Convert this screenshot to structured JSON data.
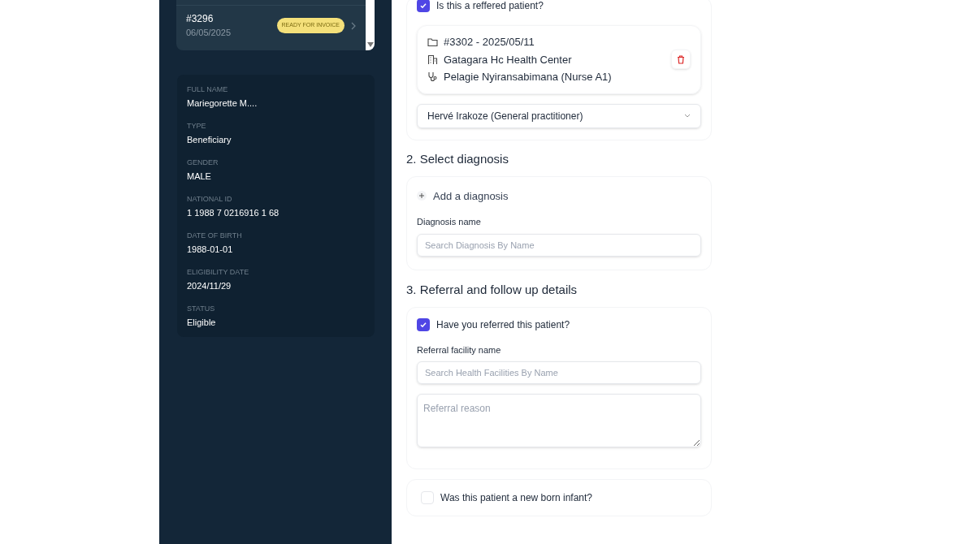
{
  "visits": [
    {
      "number": "#3296",
      "date": "06/05/2025",
      "badge": "READY FOR INVOICE"
    }
  ],
  "patient": [
    {
      "label": "FULL NAME",
      "value": "Mariegorette M...."
    },
    {
      "label": "TYPE",
      "value": "Beneficiary"
    },
    {
      "label": "GENDER",
      "value": "MALE"
    },
    {
      "label": "NATIONAL ID",
      "value": "1 1988 7 0216916 1 68"
    },
    {
      "label": "DATE OF BIRTH",
      "value": "1988-01-01"
    },
    {
      "label": "ELIGIBILITY DATE",
      "value": "2024/11/29"
    },
    {
      "label": "STATUS",
      "value": "Eligible"
    }
  ],
  "referred_patient": {
    "label": "Is this a reffered patient?",
    "checked": true,
    "referral": {
      "visit": "#3302 - 2025/05/11",
      "facility": "Gatagara Hc Health Center",
      "staff": "Pelagie Nyiransabimana (Nurse A1)"
    },
    "practitioner": "Hervé Irakoze (General practitioner)"
  },
  "diagnosis": {
    "heading": "2. Select diagnosis",
    "add": "Add a diagnosis",
    "label": "Diagnosis name",
    "placeholder": "Search Diagnosis By Name"
  },
  "referral_details": {
    "heading": "3. Referral and follow up details",
    "label": "Have you referred this patient?",
    "checked": true,
    "facility_label": "Referral facility name",
    "facility_placeholder": "Search Health Facilities By Name",
    "reason_placeholder": "Referral reason"
  },
  "newborn": {
    "label": "Was this patient a new born infant?",
    "checked": false
  }
}
